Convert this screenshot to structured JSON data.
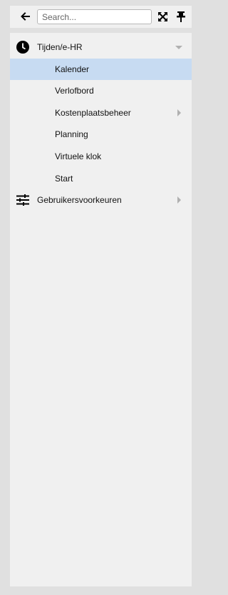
{
  "search": {
    "placeholder": "Search..."
  },
  "menu": {
    "tijden": {
      "label": "Tijden/e-HR",
      "icon": "clock-icon",
      "expanded": true,
      "items": [
        {
          "label": "Kalender",
          "selected": true
        },
        {
          "label": "Verlofbord"
        },
        {
          "label": "Kostenplaatsbeheer",
          "has_children": true
        },
        {
          "label": "Planning"
        },
        {
          "label": "Virtuele klok"
        },
        {
          "label": "Start"
        }
      ]
    },
    "prefs": {
      "label": "Gebruikersvoorkeuren",
      "icon": "sliders-icon",
      "has_children": true
    }
  },
  "colors": {
    "background": "#e0e0e0",
    "panel": "#f0f0f0",
    "selected": "#c7dbf2",
    "caret": "#b0b0b0"
  }
}
